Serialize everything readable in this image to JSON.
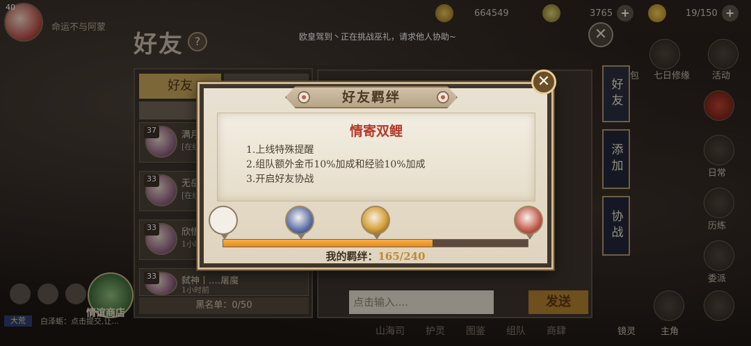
{
  "topbar": {
    "player_level": "40",
    "player_name": "命运不与阿蒙",
    "gold": "664549",
    "jade": "3765",
    "stamina": "19/150"
  },
  "friends_panel": {
    "title": "好友",
    "help_glyph": "?",
    "notice": "欧皇驾到丶正在挑战巫礼，请求他人协助~",
    "tab_friends": "好友",
    "rows": [
      {
        "level": "37",
        "name": "满月",
        "sub": "[在线]"
      },
      {
        "level": "33",
        "name": "无岳",
        "sub": "[在线]"
      },
      {
        "level": "33",
        "name": "欣悟",
        "sub": "1小时前"
      },
      {
        "level": "33",
        "name": "弑神丨.…屠魔",
        "sub": "1小时前"
      }
    ],
    "blacklist": "黑名单：0/50",
    "shop_label": "情谊商店",
    "chat_tag": "大荒",
    "chat_text": "白泽蛎：点击提交,让..."
  },
  "chat": {
    "input_placeholder": "点击输入....",
    "send_label": "发送"
  },
  "side_tabs": [
    "好友",
    "添加",
    "协战"
  ],
  "right_menu": [
    "包",
    "七日修缘",
    "活动",
    "日常",
    "历练",
    "委派",
    "镜灵",
    "主角"
  ],
  "bottom_nav": [
    "山海司",
    "护灵",
    "图鉴",
    "组队",
    "商肆"
  ],
  "modal": {
    "title": "好友羁绊",
    "close_glyph": "✕",
    "bond_name": "情寄双鲤",
    "perks": [
      "1.上线特殊提醒",
      "2.组队额外金币10%加成和经验10%加成",
      "3.开启好友协战"
    ],
    "bond_label": "我的羁绊：",
    "bond_value": "165/240",
    "progress_fraction": 0.6875
  },
  "colors": {
    "accent_gold": "#c9a65b",
    "bond_name_red": "#b43a2a",
    "progress_orange": "#e48a1e"
  }
}
